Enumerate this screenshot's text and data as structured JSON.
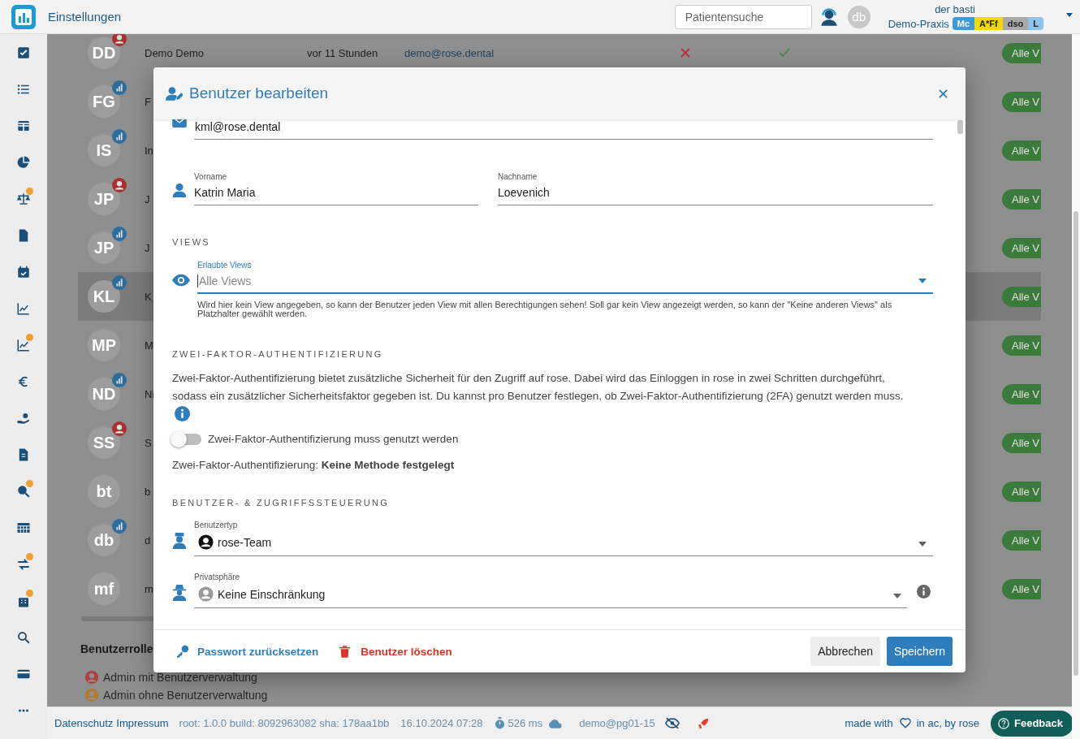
{
  "topbar": {
    "title": "Einstellungen",
    "search": {
      "placeholder": "Patientensuche"
    },
    "avatar": "db",
    "user": {
      "name": "der basti",
      "practice": "Demo-Praxis",
      "tags": [
        {
          "label": "Mc",
          "color": "#3b9ad9"
        },
        {
          "label": "A*Ff",
          "color": "#f5d800"
        },
        {
          "label": "dso",
          "color": "#a9a9a9"
        },
        {
          "label": "L",
          "color": "#8cc4ec"
        }
      ]
    }
  },
  "sidebar": {
    "items": [
      {
        "badge": false
      },
      {
        "badge": false
      },
      {
        "badge": false
      },
      {
        "badge": false
      },
      {
        "badge": true
      },
      {
        "badge": false
      },
      {
        "badge": false
      },
      {
        "badge": false
      },
      {
        "badge": true
      },
      {
        "badge": false
      },
      {
        "badge": false
      },
      {
        "badge": false
      },
      {
        "badge": true
      },
      {
        "badge": false
      },
      {
        "badge": true
      },
      {
        "badge": true
      },
      {
        "badge": false
      },
      {
        "badge": false
      },
      {
        "badge": false
      }
    ]
  },
  "users": {
    "rows": [
      {
        "initials": "DD",
        "kind": "user",
        "name": "Demo Demo",
        "last_seen": "vor 11 Stunden",
        "email": "demo@rose.dental",
        "column_5": false,
        "column_6": true,
        "views": "Alle V",
        "selected": false
      },
      {
        "initials": "FG",
        "kind": "stats",
        "name": "F",
        "views": "Alle V",
        "selected": false
      },
      {
        "initials": "IS",
        "kind": "stats",
        "name": "In",
        "views": "Alle V",
        "selected": false
      },
      {
        "initials": "JP",
        "kind": "user",
        "name": "J",
        "views": "Alle V",
        "selected": false
      },
      {
        "initials": "JP",
        "kind": "stats",
        "name": "J",
        "views": "Alle V",
        "selected": false
      },
      {
        "initials": "KL",
        "kind": "stats",
        "name": "K",
        "views": "Alle V",
        "selected": true
      },
      {
        "initials": "MP",
        "kind": "plain",
        "name": "M",
        "views": "Alle V",
        "selected": false
      },
      {
        "initials": "ND",
        "kind": "stats",
        "name": "Ni",
        "views": "Alle V",
        "selected": false
      },
      {
        "initials": "SS",
        "kind": "user",
        "name": "S",
        "views": "Alle V",
        "selected": false
      },
      {
        "initials": "bt",
        "kind": "plain",
        "name": "b",
        "views": "Alle V",
        "selected": false
      },
      {
        "initials": "db",
        "kind": "stats",
        "name": "d",
        "views": "Alle V",
        "selected": false
      },
      {
        "initials": "mf",
        "kind": "plain",
        "name": "m",
        "views": "Alle V",
        "selected": false
      }
    ],
    "roles_title": "Benutzerrolle",
    "roles": [
      {
        "label": "Admin mit Benutzerverwaltung",
        "color": "#b04040"
      },
      {
        "label": "Admin ohne Benutzerverwaltung",
        "color": "#b07a30"
      }
    ]
  },
  "dialog": {
    "title": "Benutzer bearbeiten",
    "email": "kml@rose.dental",
    "first_name": {
      "label": "Vorname",
      "value": "Katrin Maria"
    },
    "last_name": {
      "label": "Nachname",
      "value": "Loevenich"
    },
    "views_heading": "VIEWS",
    "views_field": {
      "label": "Erlaubte Views",
      "placeholder": "Alle Views",
      "focused": true,
      "hint": "Wird hier kein View angegeben, so kann der Benutzer jeden View mit allen Berechtigungen sehen! Soll gar kein View angezeigt werden, so kann der \"Keine anderen Views\" als Platzhalter gewählt werden."
    },
    "tfa_heading": "ZWEI-FAKTOR-AUTHENTIFIZIERUNG",
    "tfa_text": "Zwei-Faktor-Authentifizierung bietet zusätzliche Sicherheit für den Zugriff auf rose. Dabei wird das Einloggen in rose in zwei Schritten durchgeführt, sodass ein zusätzlicher Sicherheitsfaktor gegeben ist. Du kannst pro Benutzer festlegen, ob Zwei-Faktor-Authentifizierung (2FA) genutzt werden muss.",
    "tfa_toggle": {
      "label": "Zwei-Faktor-Authentifizierung muss genutzt werden",
      "on": false
    },
    "tfa_status": "Zwei-Faktor-Authentifizierung: **Keine Methode festgelegt**",
    "access_heading": "BENUTZER- & ZUGRIFFSSTEUERUNG",
    "user_type": {
      "label": "Benutzertyp",
      "value": "rose-Team"
    },
    "privacy": {
      "label": "Privatsphäre",
      "value": "Keine Einschränkung"
    },
    "reset_password": "Passwort zurücksetzen",
    "delete_user": "Benutzer löschen",
    "cancel": "Abbrechen",
    "save": "Speichern"
  },
  "footer": {
    "links": [
      "Datenschutz",
      "Impressum"
    ],
    "build": "root: 1.0.0 build: 8092963082 sha: 178aa1bb",
    "date": "16.10.2024 07:28",
    "timing": "526 ms",
    "server": "demo@pg01-15",
    "made_with": "made with",
    "by": "in ac, by rose",
    "feedback": "Feedback"
  }
}
